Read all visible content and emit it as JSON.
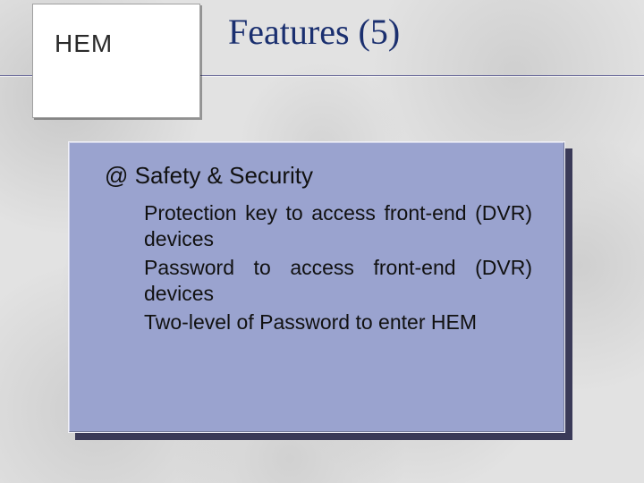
{
  "logo": {
    "label": "HEM"
  },
  "title": "Features (5)",
  "section": {
    "heading": "@ Safety & Security",
    "bullets": [
      "Protection key to access front-end (DVR) devices",
      "Password to access front-end (DVR) devices",
      "Two-level of Password to enter HEM"
    ]
  },
  "colors": {
    "title": "#1a2f6f",
    "panel": "#9aa3cf",
    "panel_shadow": "#3a3a58"
  }
}
